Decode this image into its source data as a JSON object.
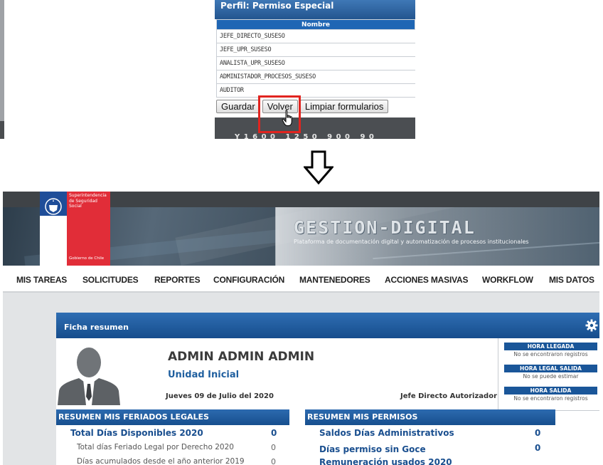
{
  "perm_panel": {
    "title": "Perfil: Permiso Especial",
    "column_header": "Nombre",
    "rows": [
      "JEFE_DIRECTO_SUSESO",
      "JEFE_UPR_SUSESO",
      "ANALISTA_UPR_SUSESO",
      "ADMINISTADOR_PROCESOS_SUSESO",
      "AUDITOR"
    ],
    "buttons": {
      "guardar": "Guardar",
      "volver": "Volver",
      "limpiar": "Limpiar formularios"
    },
    "highlight_color": "#e1241f"
  },
  "app": {
    "logo": {
      "org_lines": [
        "Superintendencia",
        "de Seguridad",
        "Social"
      ],
      "gov": "Gobierno de Chile"
    },
    "brand": {
      "title": "GESTION-DIGITAL",
      "subtitle": "Plataforma de documentación digital y automatización de procesos institucionales"
    },
    "menu": [
      "MIS TAREAS",
      "SOLICITUDES",
      "REPORTES",
      "CONFIGURACIÓN",
      "MANTENEDORES",
      "ACCIONES MASIVAS",
      "WORKFLOW",
      "MIS DATOS"
    ],
    "card": {
      "title": "Ficha resumen",
      "user_name": "ADMIN ADMIN ADMIN",
      "unit": "Unidad Inicial",
      "date": "Jueves 09 de Julio del 2020",
      "approver": "Jefe Directo Autorizador",
      "attendance": [
        {
          "label": "HORA LLEGADA",
          "value": "No se encontraron registros"
        },
        {
          "label": "HORA LEGAL SALIDA",
          "value": "No se puede estimar"
        },
        {
          "label": "HORA SALIDA",
          "value": "No se encontraron registros"
        }
      ],
      "feriados": {
        "title": "RESUMEN MIS FERIADOS LEGALES",
        "total_label": "Total Días Disponibles 2020",
        "total_value": "0",
        "items": [
          {
            "label": "Total días Feriado Legal por Derecho 2020",
            "value": "0"
          },
          {
            "label": "Días acumulados desde el año anterior 2019",
            "value": "0"
          }
        ]
      },
      "permisos": {
        "title": "RESUMEN MIS PERMISOS",
        "items": [
          {
            "label": "Saldos Días Administrativos",
            "value": "0"
          },
          {
            "label": "Días permiso sin Goce Remuneración usados 2020",
            "value": "0"
          }
        ]
      }
    },
    "colors": {
      "primary_blue": "#1a5699",
      "brand_red": "#e12d38"
    }
  }
}
